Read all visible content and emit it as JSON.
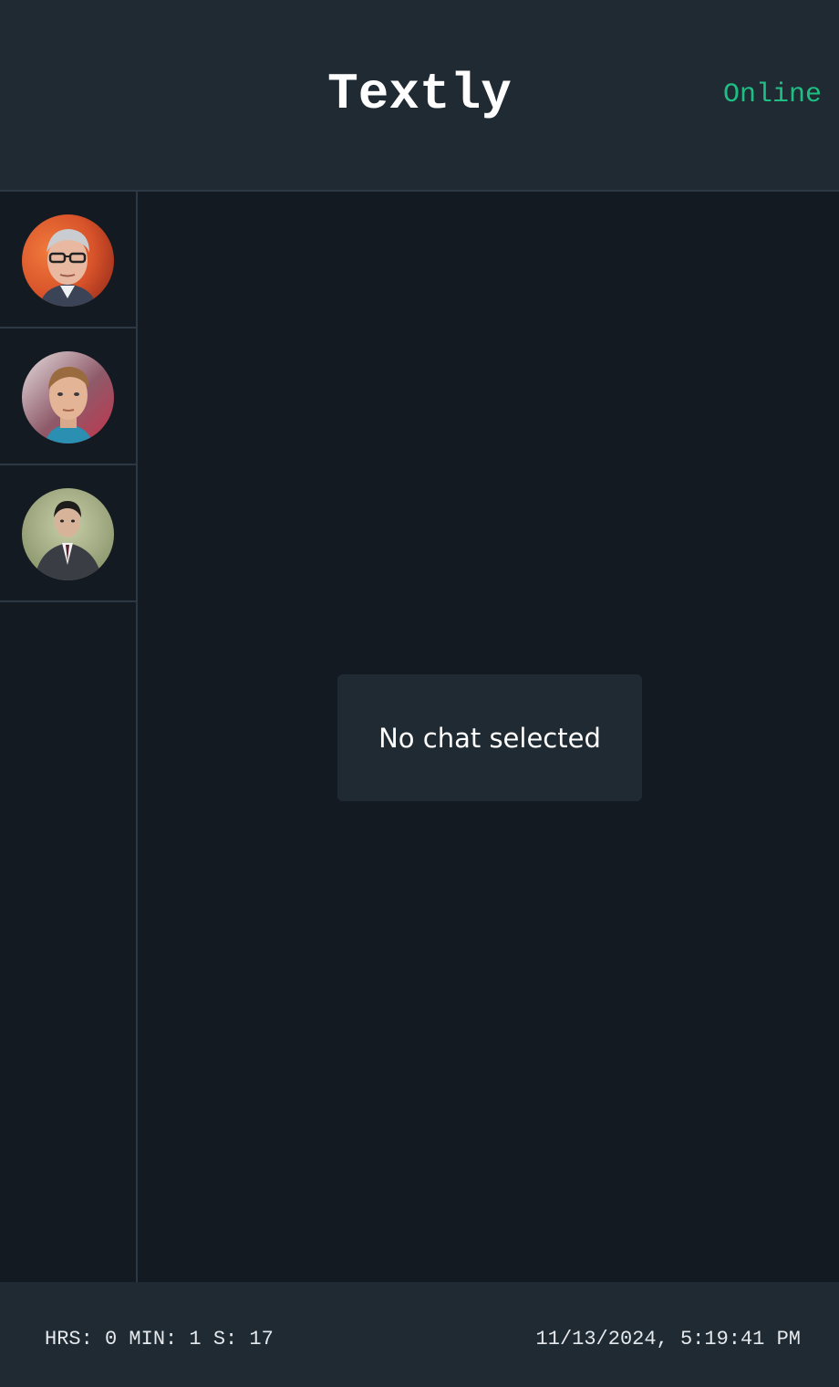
{
  "header": {
    "title": "Textly",
    "status": "Online",
    "status_color": "#1fbf83"
  },
  "sidebar": {
    "contacts": [
      {
        "avatar_icon": "portrait-avatar-gray-haired-man-glasses"
      },
      {
        "avatar_icon": "portrait-avatar-blond-man"
      },
      {
        "avatar_icon": "portrait-avatar-dark-haired-man-suit"
      }
    ]
  },
  "main": {
    "empty_message": "No chat selected"
  },
  "footer": {
    "timer": "HRS: 0 MIN: 1 S: 17",
    "datetime": "11/13/2024, 5:19:41 PM"
  }
}
